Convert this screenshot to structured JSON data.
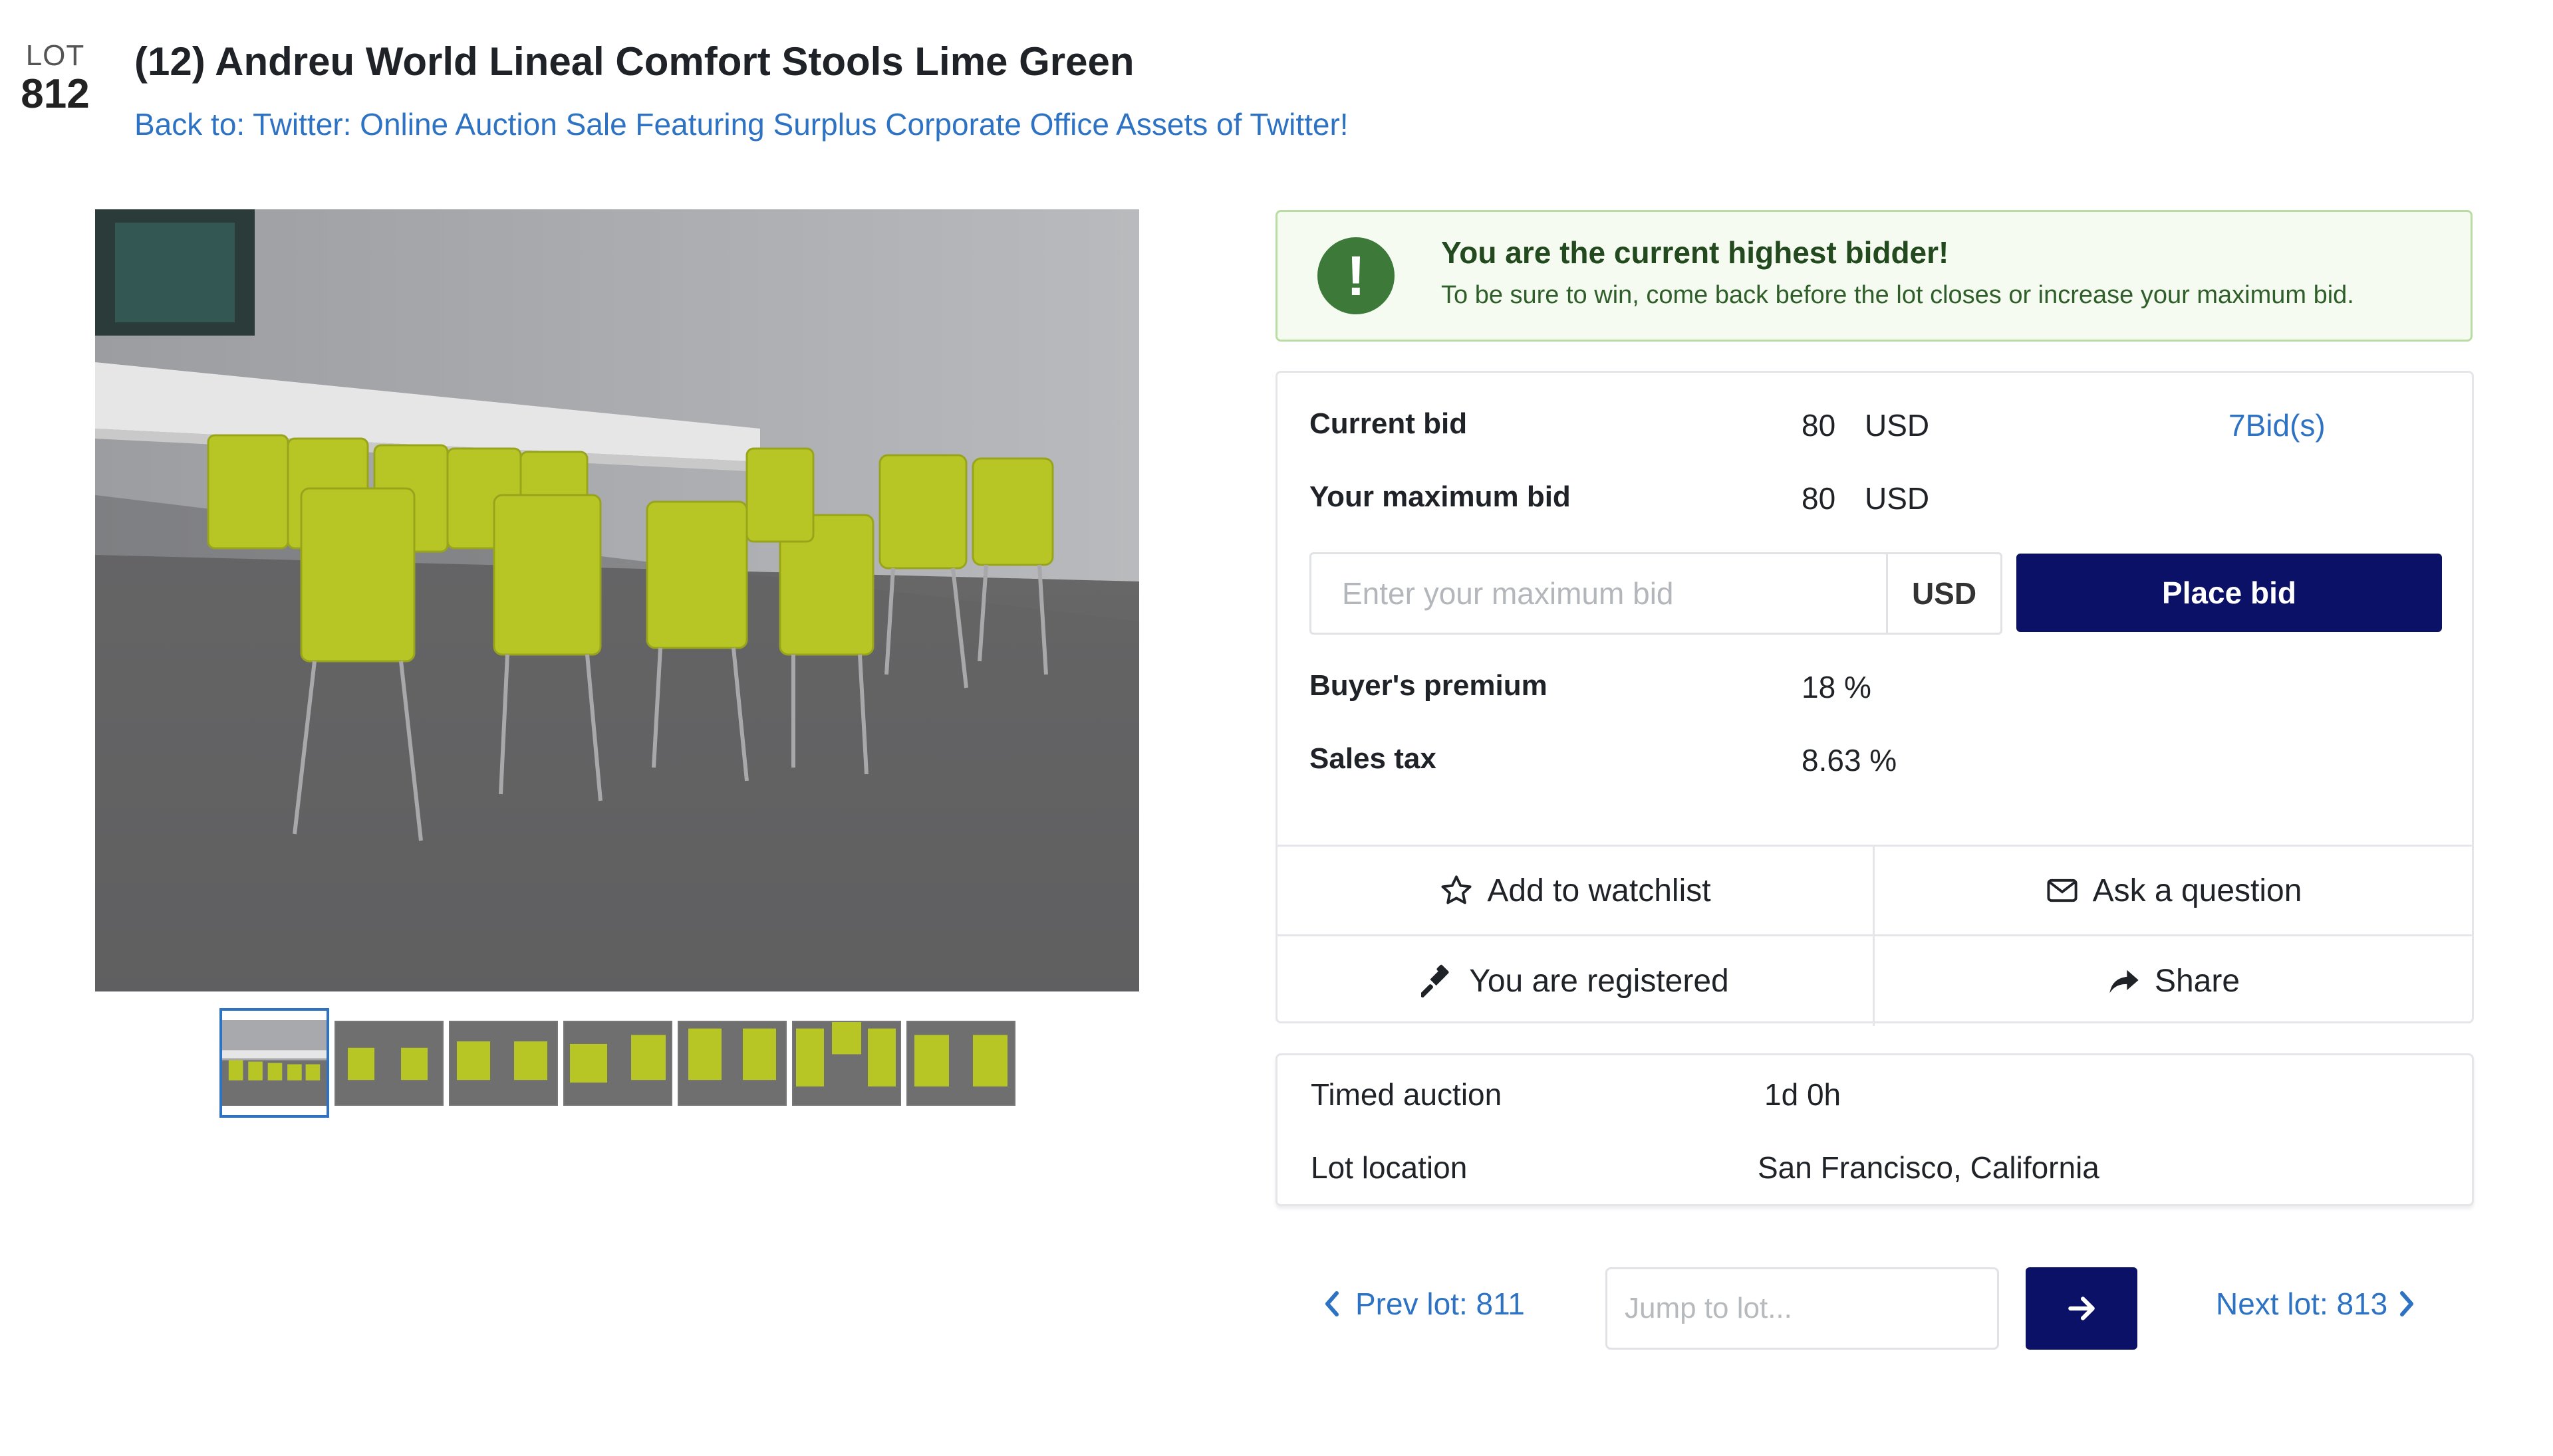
{
  "lot": {
    "label": "LOT",
    "number": "812"
  },
  "title": "(12) Andreu World Lineal Comfort Stools Lime Green",
  "back_link": "Back to: Twitter: Online Auction Sale Featuring Surplus Corporate Office Assets of Twitter!",
  "alert": {
    "headline": "You are the current highest bidder!",
    "message": "To be sure to win, come back before the lot closes or increase your maximum bid.",
    "icon": "exclamation-icon",
    "color": "#3d7a3a"
  },
  "bid": {
    "current_label": "Current bid",
    "current_value": "80",
    "current_currency": "USD",
    "bids_count": "7Bid(s)",
    "max_label": "Your maximum bid",
    "max_value": "80",
    "max_currency": "USD",
    "input_placeholder": "Enter your maximum bid",
    "input_unit": "USD",
    "place_bid_label": "Place bid",
    "premium_label": "Buyer's premium",
    "premium_value": "18 %",
    "tax_label": "Sales tax",
    "tax_value": "8.63 %"
  },
  "actions": {
    "watchlist": "Add to watchlist",
    "question": "Ask a question",
    "registered": "You are registered",
    "share": "Share"
  },
  "info": {
    "auction_label": "Timed auction",
    "auction_value": "1d 0h",
    "location_label": "Lot location",
    "location_value": "San Francisco, California"
  },
  "pager": {
    "prev_label": "Prev lot: 811",
    "jump_placeholder": "Jump to lot...",
    "next_label": "Next lot: 813"
  },
  "colors": {
    "accent": "#0b1166",
    "link": "#2e73c3",
    "success_bg": "#f5fbf0",
    "success_border": "#b9dca4"
  }
}
